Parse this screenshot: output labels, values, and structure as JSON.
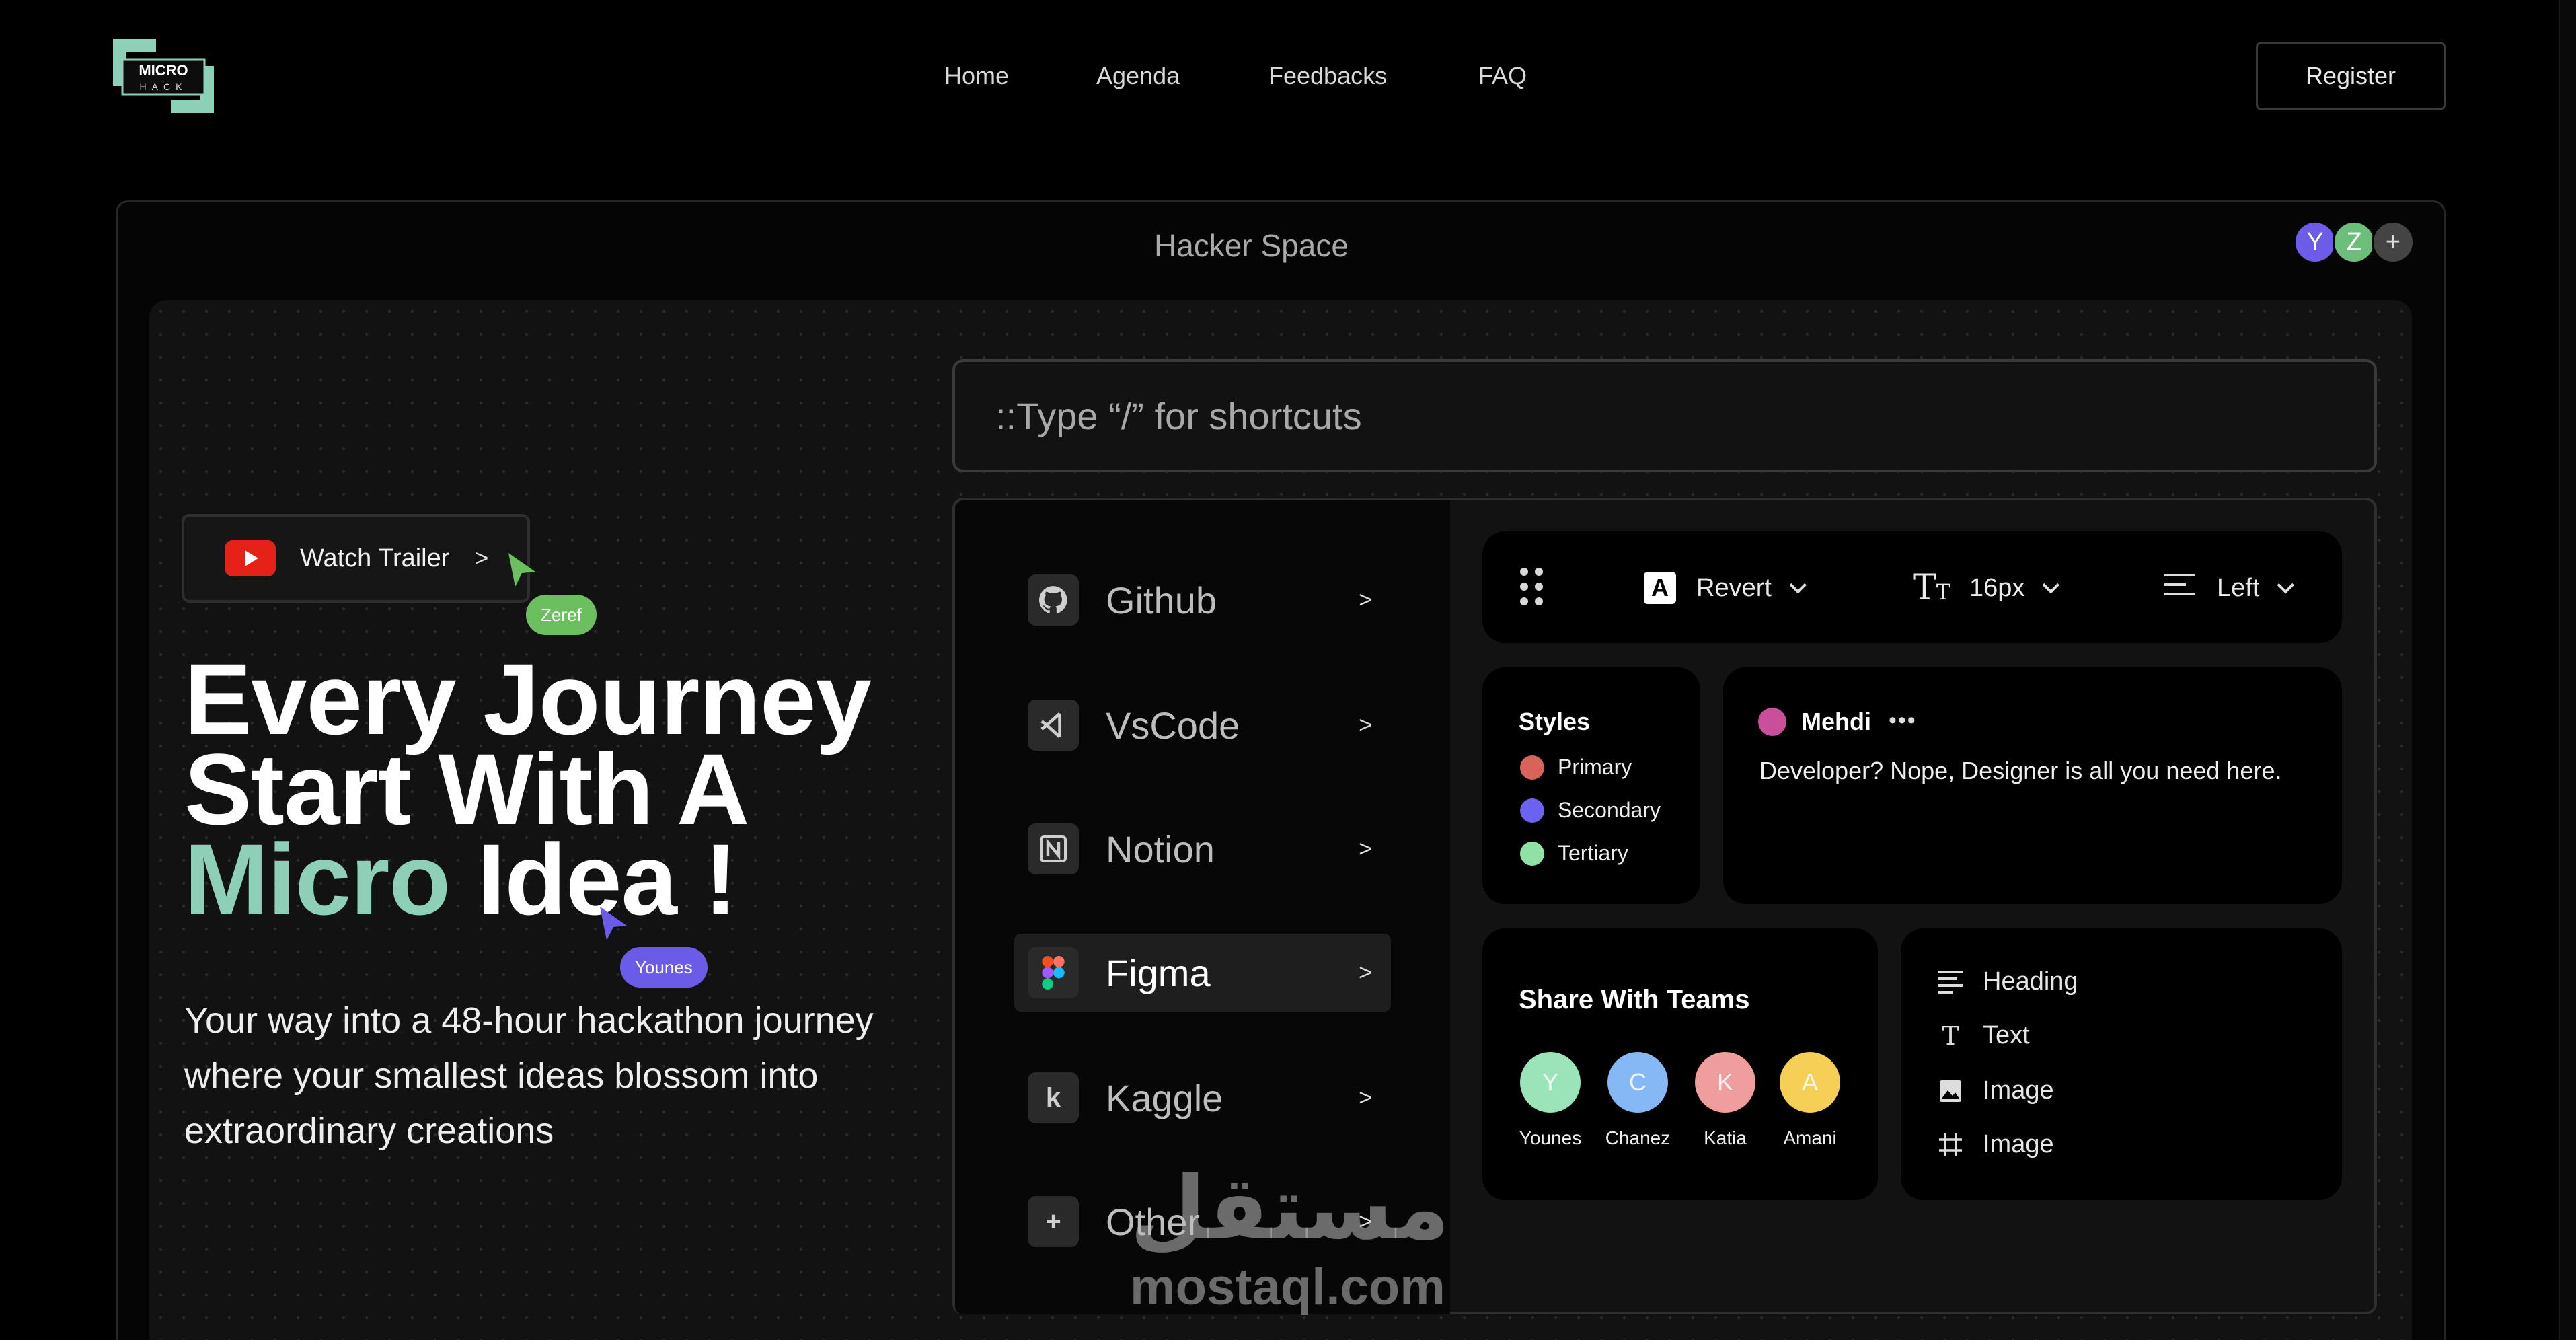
{
  "nav": {
    "logo_text_top": "MICRO",
    "logo_text_bottom": "HACK",
    "links": [
      "Home",
      "Agenda",
      "Feedbacks",
      "FAQ"
    ],
    "register_label": "Register"
  },
  "workspace": {
    "title": "Hacker Space",
    "collaborators": [
      {
        "initial": "Y",
        "color": "#6c5ce7"
      },
      {
        "initial": "Z",
        "color": "#6cbf7a"
      }
    ],
    "add_collaborator": "+"
  },
  "hero": {
    "trailer_label": "Watch Trailer",
    "trailer_chevron": ">",
    "title_line1": "Every Journey",
    "title_line2": "Start With A",
    "title_accent": "Micro",
    "title_rest": "Idea !",
    "subtitle": "Your way into a 48-hour hackathon journey where your smallest ideas blossom into extraordinary creations",
    "cursors": [
      {
        "name": "Zeref",
        "color": "#6cbf5e"
      },
      {
        "name": "Younes",
        "color": "#6b5ce7"
      }
    ]
  },
  "shortcut_input": {
    "placeholder": "::Type “/” for shortcuts",
    "value": ""
  },
  "tools": [
    {
      "label": "Github",
      "icon": "github-icon",
      "active": false
    },
    {
      "label": "VsCode",
      "icon": "vscode-icon",
      "active": false
    },
    {
      "label": "Notion",
      "icon": "notion-icon",
      "active": false
    },
    {
      "label": "Figma",
      "icon": "figma-icon",
      "active": true
    },
    {
      "label": "Kaggle",
      "icon": "kaggle-icon",
      "active": false
    },
    {
      "label": "Other",
      "icon": "plus-icon",
      "active": false
    }
  ],
  "tool_chevron": ">",
  "toolbar": {
    "font": "Revert",
    "size": "16px",
    "align": "Left"
  },
  "styles": {
    "title": "Styles",
    "items": [
      {
        "label": "Primary",
        "color": "#d9625a"
      },
      {
        "label": "Secondary",
        "color": "#6b63f0"
      },
      {
        "label": "Tertiary",
        "color": "#8fe2a4"
      }
    ]
  },
  "comment": {
    "author": "Mehdi",
    "more": "•••",
    "message": "Developer? Nope, Designer is all you need here."
  },
  "share": {
    "title": "Share With Teams",
    "members": [
      {
        "initial": "Y",
        "name": "Younes",
        "color": "#9be3b8"
      },
      {
        "initial": "C",
        "name": "Chanez",
        "color": "#86b8f5"
      },
      {
        "initial": "K",
        "name": "Katia",
        "color": "#ef9e9e"
      },
      {
        "initial": "A",
        "name": "Amani",
        "color": "#f5cf56"
      }
    ]
  },
  "blocks": [
    {
      "label": "Heading",
      "icon": "heading-icon"
    },
    {
      "label": "Text",
      "icon": "text-icon"
    },
    {
      "label": "Image",
      "icon": "image-icon"
    },
    {
      "label": "Image",
      "icon": "frame-icon"
    }
  ],
  "watermark": {
    "arabic": "مستقل",
    "latin": "mostaql.com"
  }
}
